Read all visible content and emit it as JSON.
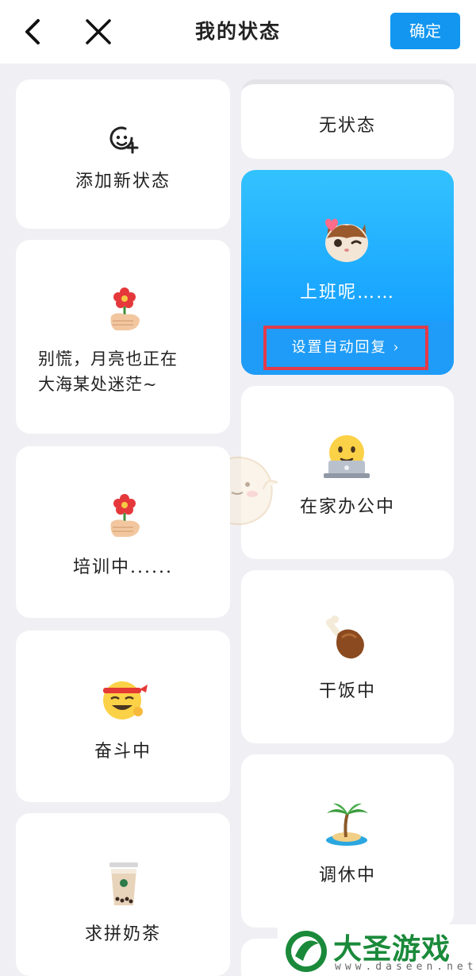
{
  "header": {
    "title": "我的状态",
    "confirm_label": "确定",
    "back_icon": "chevron-left-icon",
    "close_icon": "close-icon",
    "accent": "#1296f0"
  },
  "statuses": {
    "add": {
      "label": "添加新状态",
      "icon": "add-emoji-icon"
    },
    "none": {
      "label": "无状态"
    },
    "working": {
      "label": "上班呢……",
      "icon": "cat-face-icon",
      "auto_reply": "设置自动回复 ›",
      "selected": true
    },
    "moon": {
      "line1": "别慌，月亮也正在",
      "line2": "大海某处迷茫~",
      "icon": "flower-hand-icon"
    },
    "home": {
      "label": "在家办公中",
      "icon": "laptop-face-icon"
    },
    "training": {
      "label": "培训中......",
      "icon": "flower-hand-icon"
    },
    "eating": {
      "label": "干饭中",
      "icon": "drumstick-icon"
    },
    "fighting": {
      "label": "奋斗中",
      "icon": "headband-face-icon"
    },
    "resting": {
      "label": "调休中",
      "icon": "palm-island-icon"
    },
    "tea": {
      "label": "求拼奶茶",
      "icon": "bubble-tea-icon"
    }
  },
  "watermark": {
    "name": "大圣游戏网",
    "url": "www.daseen.net",
    "brand_color": "#1a8a3a"
  }
}
